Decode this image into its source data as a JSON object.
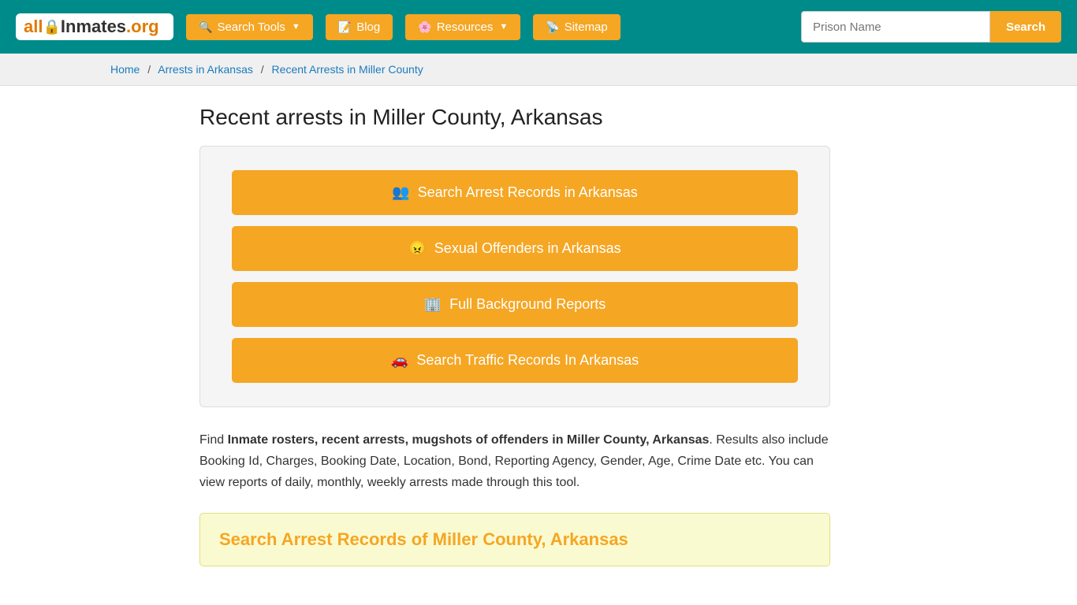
{
  "header": {
    "logo_text_all": "all",
    "logo_text_inmates": "Inmates",
    "logo_text_org": ".org",
    "nav": [
      {
        "id": "search-tools",
        "label": "Search Tools",
        "icon": "🔍",
        "has_arrow": true
      },
      {
        "id": "blog",
        "label": "Blog",
        "icon": "📝",
        "has_arrow": false
      },
      {
        "id": "resources",
        "label": "Resources",
        "icon": "🌸",
        "has_arrow": true
      },
      {
        "id": "sitemap",
        "label": "Sitemap",
        "icon": "📡",
        "has_arrow": false
      }
    ],
    "search_placeholder": "Prison Name",
    "search_button_label": "Search"
  },
  "breadcrumb": {
    "items": [
      {
        "label": "Home",
        "href": "#"
      },
      {
        "label": "Arrests in Arkansas",
        "href": "#"
      },
      {
        "label": "Recent Arrests in Miller County",
        "href": "#",
        "is_current": true
      }
    ]
  },
  "main": {
    "page_title": "Recent arrests in Miller County, Arkansas",
    "action_buttons": [
      {
        "id": "arrest-records",
        "icon": "👥",
        "label": "Search Arrest Records in Arkansas"
      },
      {
        "id": "sexual-offenders",
        "icon": "😠",
        "label": "Sexual Offenders in Arkansas"
      },
      {
        "id": "background-reports",
        "icon": "🏢",
        "label": "Full Background Reports"
      },
      {
        "id": "traffic-records",
        "icon": "🚗",
        "label": "Search Traffic Records In Arkansas"
      }
    ],
    "description_part1": "Find ",
    "description_bold": "Inmate rosters, recent arrests, mugshots of offenders in Miller County, Arkansas",
    "description_part2": ". Results also include Booking Id, Charges, Booking Date, Location, Bond, Reporting Agency, Gender, Age, Crime Date etc. You can view reports of daily, monthly, weekly arrests made through this tool.",
    "search_section_title": "Search Arrest Records of Miller County, Arkansas"
  }
}
